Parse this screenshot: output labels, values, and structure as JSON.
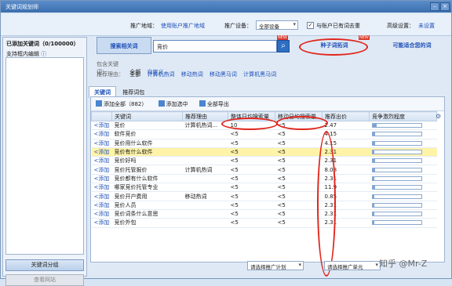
{
  "window": {
    "title": "关键词规划师"
  },
  "top": {
    "promo_label": "推广地域：",
    "promo_link": "使用账户推广地域",
    "device_label": "推广设备：",
    "device_value": "全部设备",
    "dedup_label": "与账户已有词去重",
    "advanced_label": "高级设置：",
    "advanced_value": "未设置"
  },
  "left": {
    "added_title": "已添加关键词（0/100000）",
    "support_edit": "支持框内编辑",
    "group_button": "关键词分组",
    "view_button": "查看网站"
  },
  "search": {
    "tab_search": "搜索相关词",
    "query": "竞价",
    "tab_seed": "种子词拓词",
    "tab_suggest": "可能适合您的词",
    "new_tag": "NEW"
  },
  "filters": {
    "contains_label": "包含关键词：",
    "contains_all": "全部",
    "contains_custom": "自定义",
    "reason_label": "推荐理由：",
    "reason_all": "全部",
    "reason_items": [
      "计算机热词",
      "移动热词",
      "移动黑马词",
      "计算机黑马词"
    ]
  },
  "subtabs": {
    "active": "关键词",
    "other": "推荐词包"
  },
  "toolbar": {
    "add_all": "添加全部（882）",
    "add_selected": "添加选中",
    "export_all": "全部导出"
  },
  "table": {
    "headers": [
      "",
      "关键词",
      "推荐理由",
      "整体日均搜索量",
      "移动日均搜索量",
      "推荐出价",
      "竞争激烈程度"
    ],
    "add_label": "<添加",
    "rows": [
      {
        "kw": "竞价",
        "reason": "计算机热词...",
        "total": "10",
        "mobile": "<5",
        "bid": "2.47",
        "comp": 0.08,
        "hl": false
      },
      {
        "kw": "软件竞价",
        "reason": "",
        "total": "<5",
        "mobile": "<5",
        "bid": "4.15",
        "comp": 0.05,
        "hl": false
      },
      {
        "kw": "竞价用什么软件",
        "reason": "",
        "total": "<5",
        "mobile": "<5",
        "bid": "4.15",
        "comp": 0.05,
        "hl": false
      },
      {
        "kw": "竞价有什么软件",
        "reason": "",
        "total": "<5",
        "mobile": "<5",
        "bid": "2.31",
        "comp": 0.04,
        "hl": true
      },
      {
        "kw": "竞价好吗",
        "reason": "",
        "total": "<5",
        "mobile": "<5",
        "bid": "2.31",
        "comp": 0.05,
        "hl": false
      },
      {
        "kw": "竞价托管报价",
        "reason": "计算机热词",
        "total": "<5",
        "mobile": "<5",
        "bid": "8.08",
        "comp": 0.05,
        "hl": false
      },
      {
        "kw": "竞价都有什么软件",
        "reason": "",
        "total": "<5",
        "mobile": "<5",
        "bid": "2.31",
        "comp": 0.04,
        "hl": false
      },
      {
        "kw": "哪家竞价托管专业",
        "reason": "",
        "total": "<5",
        "mobile": "<5",
        "bid": "11.9",
        "comp": 0.05,
        "hl": false
      },
      {
        "kw": "竞价开户费用",
        "reason": "移动热词",
        "total": "<5",
        "mobile": "<5",
        "bid": "0.85",
        "comp": 0.04,
        "hl": false
      },
      {
        "kw": "竞价人员",
        "reason": "",
        "total": "<5",
        "mobile": "<5",
        "bid": "2.31",
        "comp": 0.04,
        "hl": false
      },
      {
        "kw": "竞价词条什么意思",
        "reason": "",
        "total": "<5",
        "mobile": "<5",
        "bid": "2.31",
        "comp": 0.04,
        "hl": false
      },
      {
        "kw": "竞价外包",
        "reason": "",
        "total": "<5",
        "mobile": "<5",
        "bid": "2.31",
        "comp": 0.04,
        "hl": false
      }
    ]
  },
  "bottom": {
    "plan_select": "请选择推广计划",
    "unit_select": "请选择推广单元",
    "watermark": "知乎 @Mr-Z"
  }
}
